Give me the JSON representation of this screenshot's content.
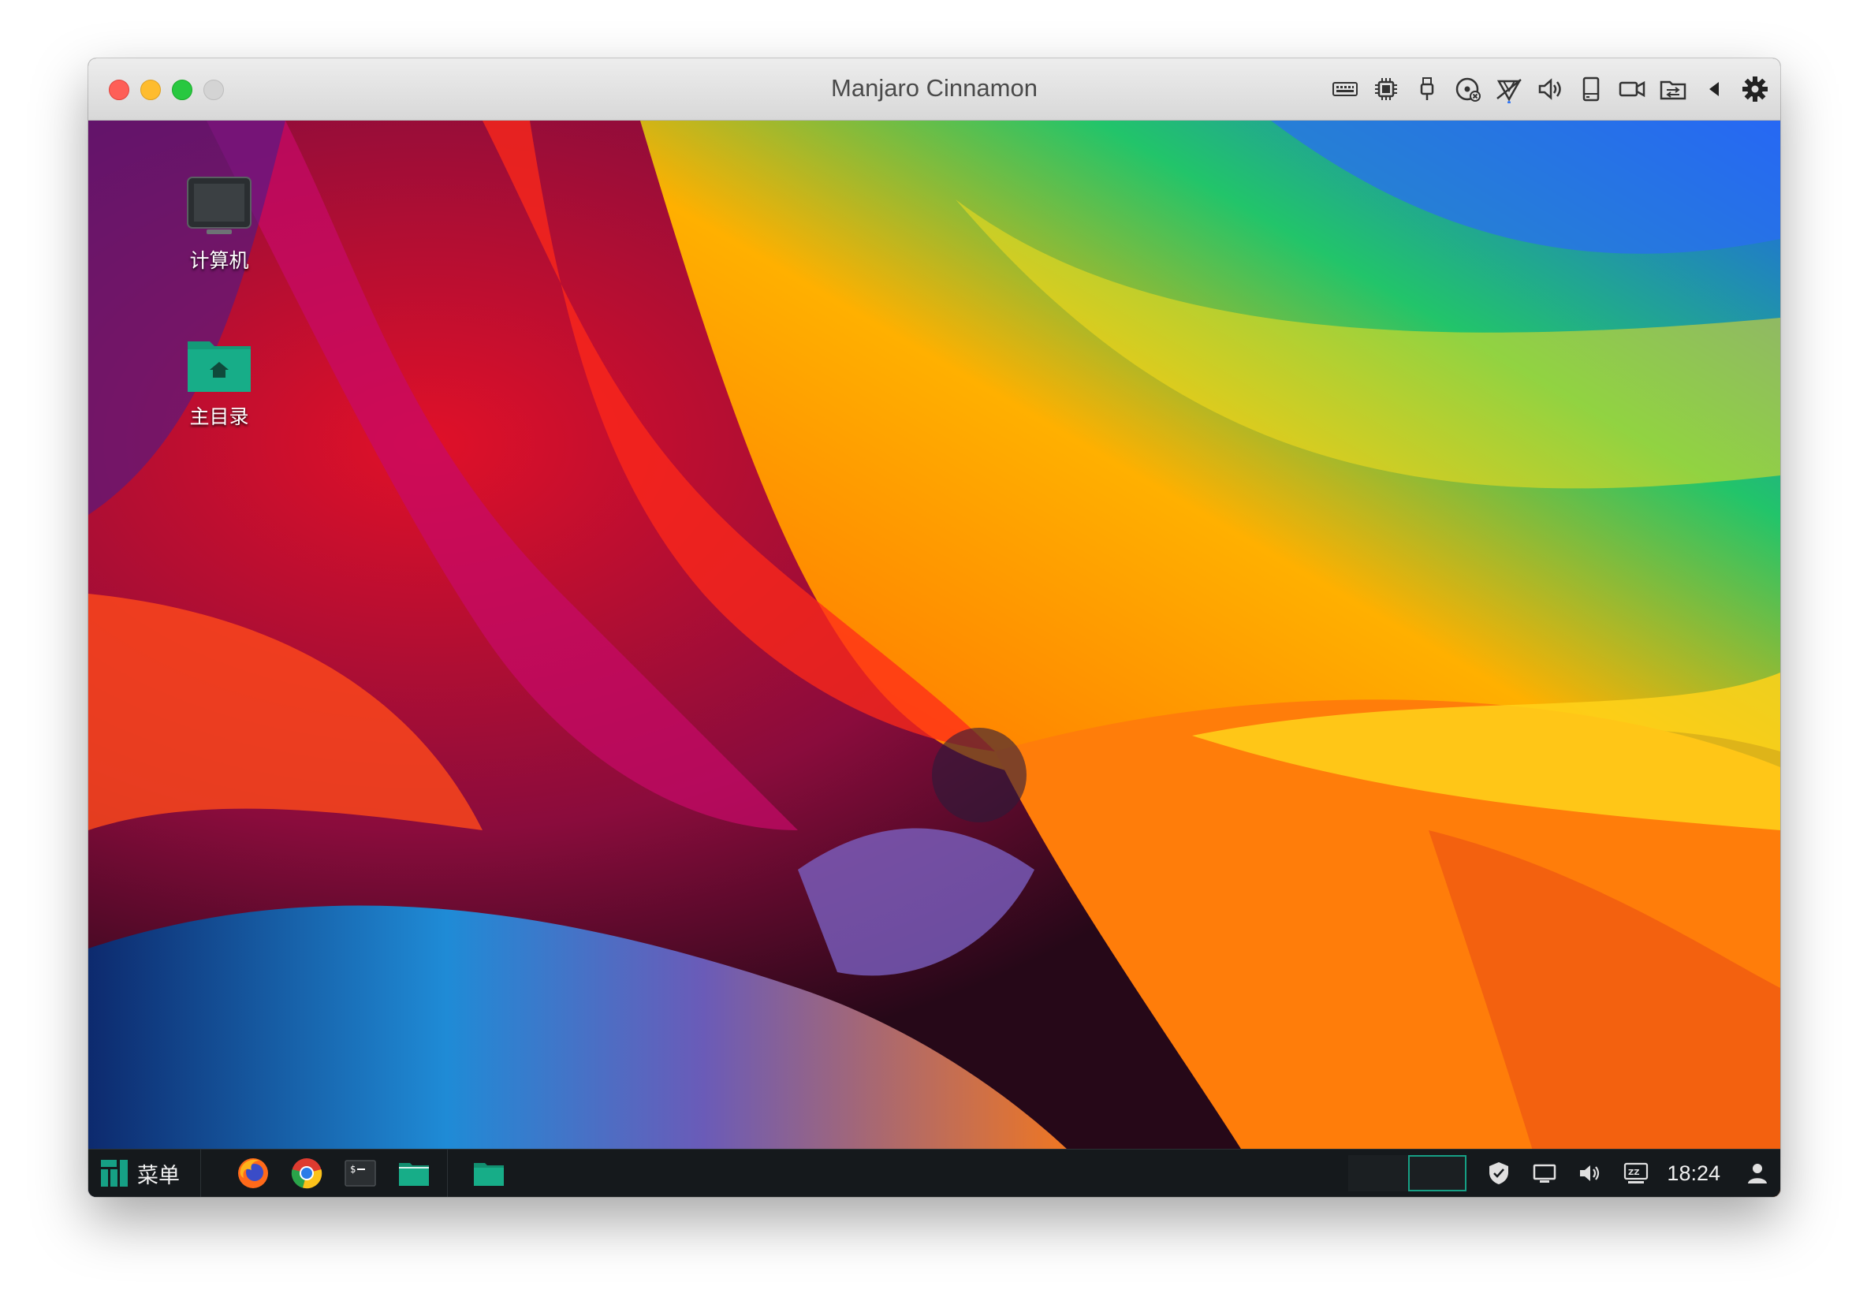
{
  "window": {
    "title": "Manjaro Cinnamon",
    "toolbar_icons": [
      "keyboard-icon",
      "cpu-icon",
      "usb-icon",
      "cd-drive-icon",
      "network-icon",
      "audio-icon",
      "storage-icon",
      "camera-icon",
      "shared-folder-icon",
      "collapse-arrow-icon",
      "settings-gear-icon"
    ]
  },
  "desktop": {
    "icons": [
      {
        "label": "计算机",
        "icon": "computer-icon"
      },
      {
        "label": "主目录",
        "icon": "home-folder-icon"
      }
    ]
  },
  "taskbar": {
    "menu_label": "菜单",
    "launchers": [
      "firefox-icon",
      "chrome-icon",
      "terminal-icon",
      "file-manager-icon"
    ],
    "open_window": "file-manager-window-icon",
    "tray": [
      "shield-icon",
      "display-icon",
      "volume-icon",
      "keyboard-layout-icon",
      "user-icon"
    ],
    "time": "18:24"
  },
  "colors": {
    "manjaro_green": "#16a085",
    "panel_bg": "#15191c"
  }
}
